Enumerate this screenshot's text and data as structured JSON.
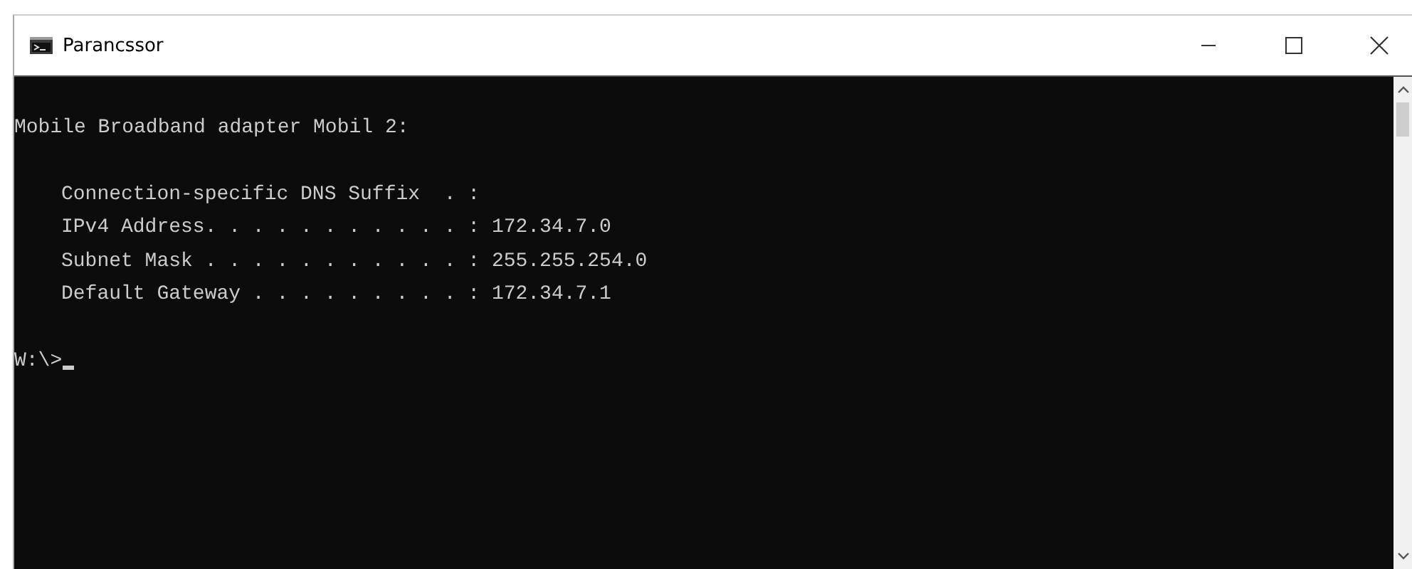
{
  "window": {
    "title": "Parancssor"
  },
  "console": {
    "heading": "Mobile Broadband adapter Mobil 2:",
    "entries": [
      {
        "label": "Connection-specific DNS Suffix  . :"
      },
      {
        "label": "IPv4 Address. . . . . . . . . . . :",
        "value": "172.34.7.0"
      },
      {
        "label": "Subnet Mask . . . . . . . . . . . :",
        "value": "255.255.254.0"
      },
      {
        "label": "Default Gateway . . . . . . . . . :",
        "value": "172.34.7.1"
      }
    ],
    "prompt": "W:\\>"
  }
}
